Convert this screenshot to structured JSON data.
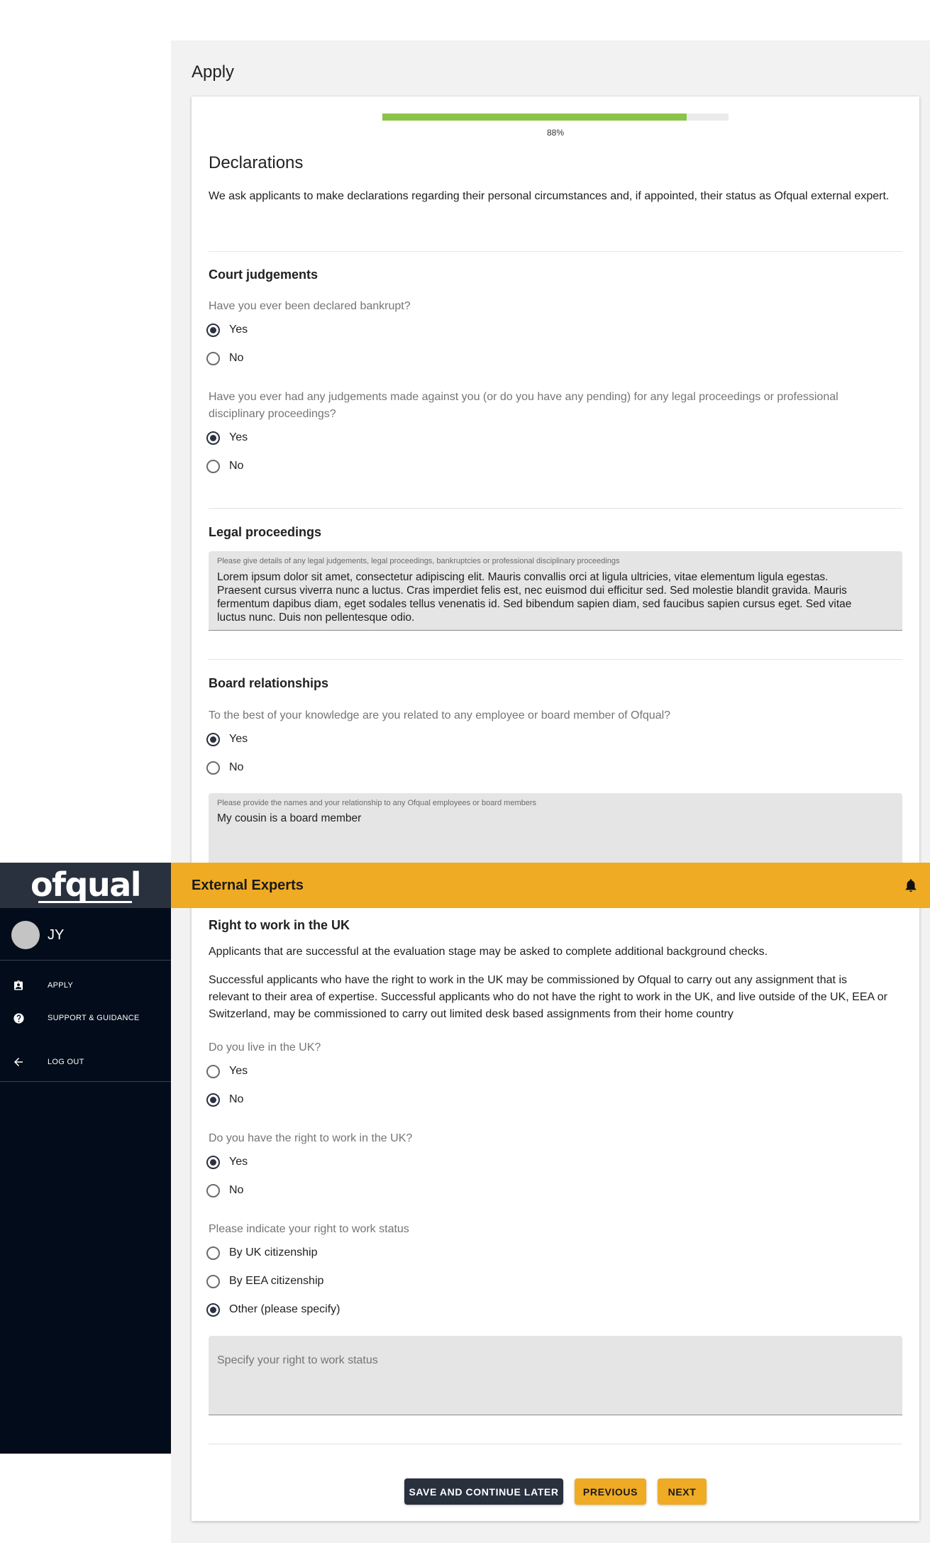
{
  "page": {
    "title": "Apply"
  },
  "progress": {
    "percent": 88,
    "label": "88%"
  },
  "declarations": {
    "title": "Declarations",
    "intro": "We ask applicants to make declarations regarding their personal circumstances and, if appointed, their status as Ofqual external expert."
  },
  "court_judgements": {
    "title": "Court judgements",
    "q1": {
      "label": "Have you ever been declared bankrupt?",
      "options": [
        "Yes",
        "No"
      ],
      "selected": "Yes"
    },
    "q2": {
      "label_line1": "Have you ever had any judgements made against you (or do you have any pending) for any legal proceedings or professional",
      "label_line2": "disciplinary proceedings?",
      "options": [
        "Yes",
        "No"
      ],
      "selected": "Yes"
    }
  },
  "legal_proceedings": {
    "title": "Legal proceedings",
    "field_label": "Please give details of any legal judgements, legal proceedings, bankruptcies or professional disciplinary proceedings",
    "lines": [
      "Lorem ipsum dolor sit amet, consectetur adipiscing elit. Mauris convallis orci at ligula ultricies, vitae elementum ligula egestas.",
      "Praesent cursus viverra nunc a luctus. Cras imperdiet felis est, nec euismod dui efficitur sed. Sed molestie blandit gravida. Mauris",
      "fermentum dapibus diam, eget sodales tellus venenatis id. Sed bibendum sapien diam, sed faucibus sapien cursus eget. Sed vitae",
      "luctus nunc. Duis non pellentesque odio."
    ]
  },
  "board_relationships": {
    "title": "Board relationships",
    "question": "To the best of your knowledge are you related to any employee or board member of Ofqual?",
    "options": [
      "Yes",
      "No"
    ],
    "selected": "Yes",
    "field_label": "Please provide the names and your relationship to any Ofqual employees or board members",
    "field_value": "My cousin is a board member"
  },
  "right_to_work": {
    "title": "Right to work in the UK",
    "para1": "Applicants that are successful at the evaluation stage may be asked to complete additional background checks.",
    "para2_line1": "Successful applicants who have the right to work in the UK may be commissioned by Ofqual to carry out any assignment that is",
    "para2_line2": "relevant to their area of expertise. Successful applicants who do not have the right to work in the UK, and live outside of the UK, EEA or",
    "para2_line3": "Switzerland, may be commissioned to carry out limited desk based assignments from their home country",
    "q_live": {
      "label": "Do you live in the UK?",
      "options": [
        "Yes",
        "No"
      ],
      "selected": "No"
    },
    "q_right": {
      "label": "Do you have the right to work in the UK?",
      "options": [
        "Yes",
        "No"
      ],
      "selected": "Yes"
    },
    "q_status": {
      "label": "Please indicate your right to work status",
      "options": [
        "By UK citizenship",
        "By EEA citizenship",
        "Other (please specify)"
      ],
      "selected": "Other (please specify)"
    },
    "specify_placeholder": "Specify your right to work status"
  },
  "buttons": {
    "save": "SAVE AND CONTINUE LATER",
    "previous": "PREVIOUS",
    "next": "NEXT"
  },
  "header": {
    "title": "External Experts"
  },
  "sidebar": {
    "logo": "ofqual",
    "user_initials": "JY",
    "items": [
      {
        "label": "APPLY",
        "icon": "badge-icon"
      },
      {
        "label": "SUPPORT & GUIDANCE",
        "icon": "help-circle-icon"
      },
      {
        "label": "LOG OUT",
        "icon": "arrow-left-icon"
      }
    ]
  },
  "colors": {
    "accent": "#efab23",
    "sidebar": "#030c1a",
    "progress": "#8bc34a",
    "button_dark": "#29303e"
  }
}
